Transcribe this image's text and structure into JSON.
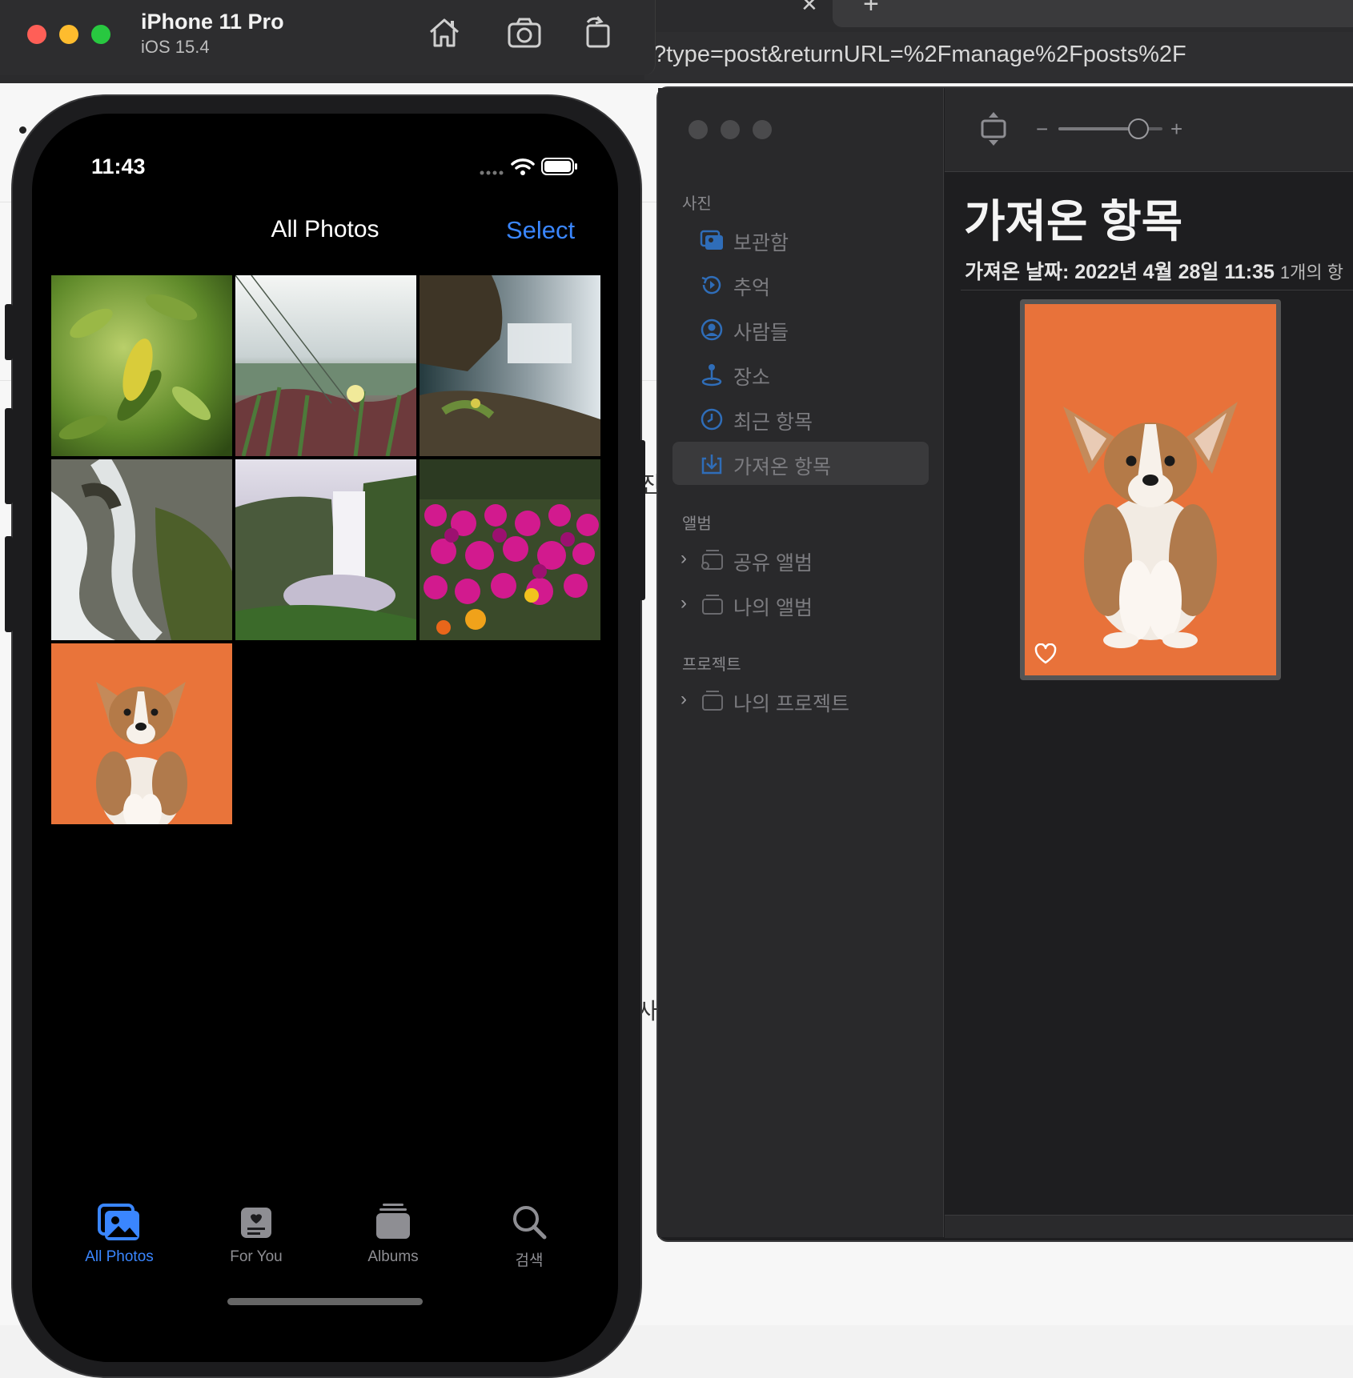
{
  "browser": {
    "url": "?type=post&returnURL=%2Fmanage%2Fposts%2F",
    "tab_close": "✕",
    "tab_new": "+",
    "peek_text_1": "진",
    "peek_text_2": "사"
  },
  "simulator": {
    "device": "iPhone 11 Pro",
    "os": "iOS 15.4",
    "tools": [
      "home-icon",
      "screenshot-icon",
      "rotate-icon"
    ]
  },
  "iphone": {
    "time": "11:43",
    "nav_title": "All Photos",
    "select_label": "Select",
    "thumbnails": [
      "leaves",
      "beach-grass",
      "waterfall-cliff",
      "waterfall-rocks",
      "skogafoss-waterfall",
      "pink-flowers",
      "corgi-puppy"
    ],
    "tabs": [
      {
        "label": "All Photos",
        "icon": "photos-icon",
        "active": true
      },
      {
        "label": "For You",
        "icon": "for-you-icon",
        "active": false
      },
      {
        "label": "Albums",
        "icon": "albums-icon",
        "active": false
      },
      {
        "label": "검색",
        "icon": "search-icon",
        "active": false
      }
    ],
    "accent": "#3a86ff"
  },
  "photos_app": {
    "zoom_minus": "−",
    "zoom_plus": "+",
    "zoom_level": 0.7,
    "sections": {
      "photos": "사진",
      "albums": "앨범",
      "projects": "프로젝트"
    },
    "library_items": [
      {
        "label": "보관함",
        "icon": "library-icon"
      },
      {
        "label": "추억",
        "icon": "memories-icon"
      },
      {
        "label": "사람들",
        "icon": "people-icon"
      },
      {
        "label": "장소",
        "icon": "places-icon"
      },
      {
        "label": "최근 항목",
        "icon": "recents-icon"
      },
      {
        "label": "가져온 항목",
        "icon": "imports-icon",
        "selected": true
      }
    ],
    "album_items": [
      {
        "label": "공유 앨범",
        "icon": "shared-album-icon"
      },
      {
        "label": "나의 앨범",
        "icon": "album-icon"
      }
    ],
    "project_items": [
      {
        "label": "나의 프로젝트",
        "icon": "project-icon"
      }
    ],
    "content_title": "가져온 항목",
    "content_subtitle": "가져온 날짜: 2022년 4월 28일 11:35",
    "content_count": "1개의 항"
  }
}
